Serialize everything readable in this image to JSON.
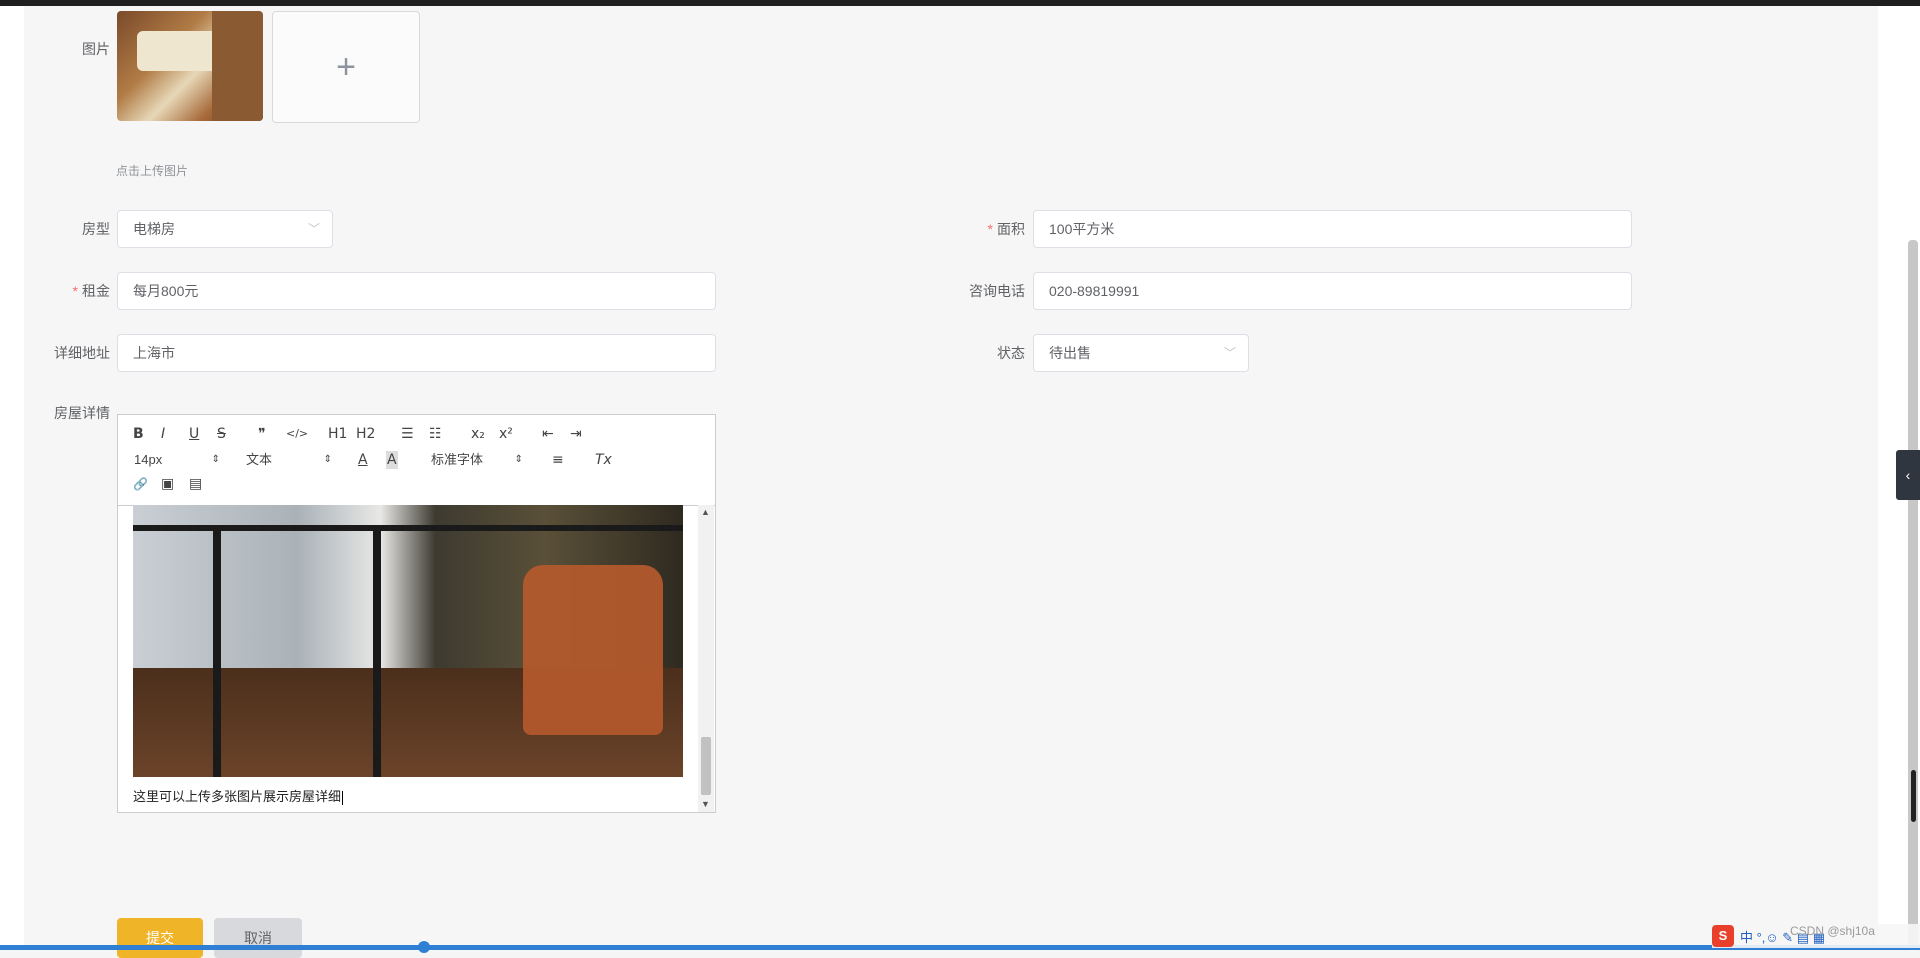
{
  "form": {
    "image_label": "图片",
    "upload_plus": "+",
    "upload_hint": "点击上传图片",
    "room_type_label": "房型",
    "room_type_value": "电梯房",
    "area_label": "面积",
    "area_value": "100平方米",
    "rent_label": "租金",
    "rent_value": "每月800元",
    "phone_label": "咨询电话",
    "phone_value": "020-89819991",
    "address_label": "详细地址",
    "address_value": "上海市",
    "status_label": "状态",
    "status_value": "待出售",
    "details_label": "房屋详情",
    "required_mark": "*"
  },
  "editor": {
    "toolbar": {
      "bold": "B",
      "italic": "I",
      "underline": "U",
      "strike": "S",
      "quote": "❞",
      "code": "</>",
      "h1": "H1",
      "h2": "H2",
      "ordered_list": "☰",
      "bullet_list": "☷",
      "subscript": "x₂",
      "superscript": "x²",
      "outdent": "⇤",
      "indent": "⇥",
      "font_size": "14px",
      "paragraph": "文本",
      "font_color": "A",
      "bg_color": "A",
      "font_family": "标准字体",
      "align": "≡",
      "clean": "Tx",
      "link": "🔗",
      "image": "▣",
      "video": "▤"
    },
    "content_text": "这里可以上传多张图片展示房屋详细"
  },
  "actions": {
    "submit": "提交",
    "cancel": "取消"
  },
  "system": {
    "ime_logo": "S",
    "ime_text": "中 °,☺ ✎ ▤ ▦",
    "watermark": "CSDN @shj10a",
    "collapse_icon": "‹"
  }
}
